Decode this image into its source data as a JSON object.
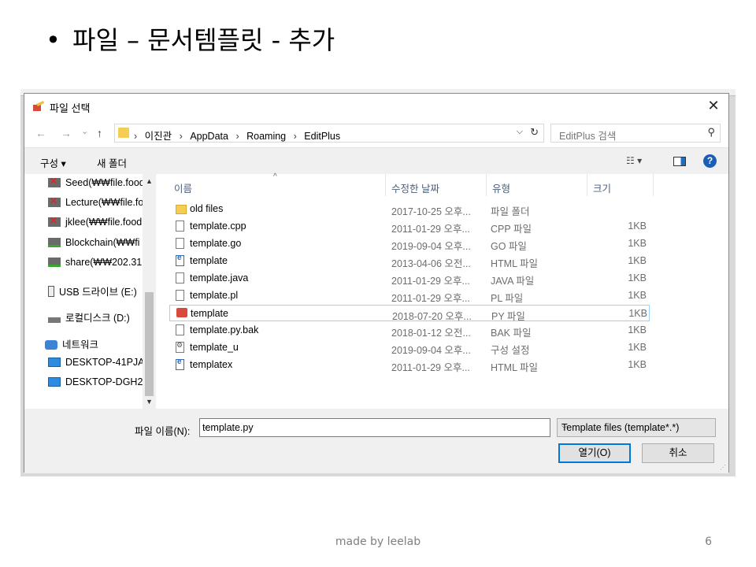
{
  "slide": {
    "bullet": "•",
    "title": "파일 – 문서템플릿 - 추가",
    "footer": "made by leelab",
    "page_number": "6"
  },
  "dialog": {
    "title": "파일 선택",
    "close_glyph": "✕",
    "nav": {
      "back": "←",
      "forward": "→",
      "recent": "⌄",
      "up": "↑"
    },
    "breadcrumb": [
      "이진관",
      "AppData",
      "Roaming",
      "EditPlus"
    ],
    "breadcrumb_sep": "›",
    "search_placeholder": "EditPlus 검색",
    "toolbar": {
      "organize": "구성 ▾",
      "new_folder": "새 폴더",
      "view": "☷ ▾",
      "help": "?"
    },
    "nav_pane": [
      {
        "label": "Seed(₩₩file.food",
        "icon": "network-drive-disconnected-icon"
      },
      {
        "label": "Lecture(₩₩file.fo",
        "icon": "network-drive-disconnected-icon"
      },
      {
        "label": "jklee(₩₩file.food",
        "icon": "network-drive-disconnected-icon"
      },
      {
        "label": "Blockchain(₩₩fi",
        "icon": "network-drive-icon"
      },
      {
        "label": "share(₩₩202.31",
        "icon": "network-drive-icon"
      },
      {
        "label": "USB 드라이브 (E:)",
        "icon": "usb-drive-icon"
      },
      {
        "label": "로컬디스크 (D:)",
        "icon": "local-disk-icon"
      },
      {
        "label": "네트워크",
        "icon": "network-icon"
      },
      {
        "label": "DESKTOP-41PJA",
        "icon": "computer-icon"
      },
      {
        "label": "DESKTOP-DGH2",
        "icon": "computer-icon"
      }
    ],
    "columns": [
      "이름",
      "수정한 날짜",
      "유형",
      "크기"
    ],
    "files": [
      {
        "name": "old files",
        "date": "2017-10-25 오후...",
        "type": "파일 폴더",
        "size": "",
        "icon": "folder"
      },
      {
        "name": "template.cpp",
        "date": "2011-01-29 오후...",
        "type": "CPP 파일",
        "size": "1KB",
        "icon": "file"
      },
      {
        "name": "template.go",
        "date": "2019-09-04 오후...",
        "type": "GO 파일",
        "size": "1KB",
        "icon": "file"
      },
      {
        "name": "template",
        "date": "2013-04-06 오전...",
        "type": "HTML 파일",
        "size": "1KB",
        "icon": "html"
      },
      {
        "name": "template.java",
        "date": "2011-01-29 오후...",
        "type": "JAVA 파일",
        "size": "1KB",
        "icon": "file"
      },
      {
        "name": "template.pl",
        "date": "2011-01-29 오후...",
        "type": "PL 파일",
        "size": "1KB",
        "icon": "file"
      },
      {
        "name": "template",
        "date": "2018-07-20 오후...",
        "type": "PY 파일",
        "size": "1KB",
        "icon": "py",
        "selected": true
      },
      {
        "name": "template.py.bak",
        "date": "2018-01-12 오전...",
        "type": "BAK 파일",
        "size": "1KB",
        "icon": "file"
      },
      {
        "name": "template_u",
        "date": "2019-09-04 오후...",
        "type": "구성 설정",
        "size": "1KB",
        "icon": "cfg"
      },
      {
        "name": "templatex",
        "date": "2011-01-29 오후...",
        "type": "HTML 파일",
        "size": "1KB",
        "icon": "html"
      }
    ],
    "filename_label": "파일 이름(N):",
    "filename_value": "template.py",
    "filter_value": "Template files (template*.*)",
    "open_button": "열기(O)",
    "cancel_button": "취소"
  }
}
